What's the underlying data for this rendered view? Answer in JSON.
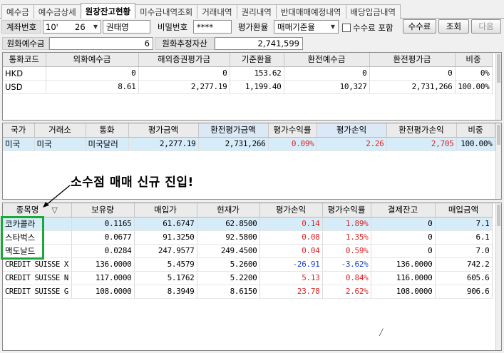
{
  "tabs": [
    {
      "label": "예수금"
    },
    {
      "label": "예수금상세"
    },
    {
      "label": "원장잔고현황"
    },
    {
      "label": "미수금내역조회"
    },
    {
      "label": "거래내역"
    },
    {
      "label": "권리내역"
    },
    {
      "label": "반대매매예정내역"
    },
    {
      "label": "배당입금내역"
    }
  ],
  "active_tab": "원장잔고현황",
  "controls": {
    "account_label": "계좌번호",
    "account_number": "10'",
    "account_suffix": "26",
    "account_name": "권태영",
    "password_label": "비밀번호",
    "password_value": "****",
    "eval_rate_label": "평가환율",
    "eval_rate_value": "매매기준율",
    "fee_checkbox_label": "수수료 포함",
    "fee_button": "수수료",
    "query_button": "조회",
    "next_button": "다음",
    "deposit_label": "원화예수금",
    "deposit_value": "6",
    "est_assets_label": "원화추정자산",
    "est_assets_value": "2,741,599"
  },
  "currency_table": {
    "headers": [
      "통화코드",
      "외화예수금",
      "해외증권평가금",
      "기준환율",
      "환전예수금",
      "환전평가금",
      "비중"
    ],
    "rows": [
      [
        "HKD",
        "0",
        "0",
        "153.62",
        "0",
        "0",
        "0%"
      ],
      [
        "USD",
        "8.61",
        "2,277.19",
        "1,199.40",
        "10,327",
        "2,731,266",
        "100.00%"
      ]
    ]
  },
  "country_table": {
    "headers": [
      "국가",
      "거래소",
      "통화",
      "평가금액",
      "환전평가금액",
      "평가수익률",
      "평가손익",
      "환전평가손익",
      "비중"
    ],
    "rows": [
      [
        "미국",
        "미국",
        "미국달러",
        "2,277.19",
        "2,731,266",
        "0.09%",
        "2.26",
        "2,705",
        "100.00%"
      ]
    ]
  },
  "annotation": "소수점 매매 신규 진입!",
  "holdings_table": {
    "headers": [
      "종목명",
      "보유량",
      "매입가",
      "현재가",
      "평가손익",
      "평가수익률",
      "결제잔고",
      "매입금액"
    ],
    "rows": [
      [
        "코카콜라",
        "0.1165",
        "61.6747",
        "62.8500",
        "0.14",
        "1.89%",
        "0",
        "7.1"
      ],
      [
        "스타벅스",
        "0.0677",
        "91.3250",
        "92.5800",
        "0.08",
        "1.35%",
        "0",
        "6.1"
      ],
      [
        "맥도날드",
        "0.0284",
        "247.9577",
        "249.4500",
        "0.04",
        "0.59%",
        "0",
        "7.0"
      ],
      [
        "CREDIT SUISSE X",
        "136.0000",
        "5.4579",
        "5.2600",
        "-26.91",
        "-3.62%",
        "136.0000",
        "742.2"
      ],
      [
        "CREDIT SUISSE N",
        "117.0000",
        "5.1762",
        "5.2200",
        "5.13",
        "0.84%",
        "116.0000",
        "605.6"
      ],
      [
        "CREDIT SUISSE G",
        "108.0000",
        "8.3949",
        "8.6150",
        "23.78",
        "2.62%",
        "108.0000",
        "906.6"
      ]
    ]
  },
  "colors": {
    "positive": "#e02424",
    "negative": "#1a3fd1",
    "highlight_box": "#1aa83a",
    "selected_row": "#d7ecf9"
  }
}
